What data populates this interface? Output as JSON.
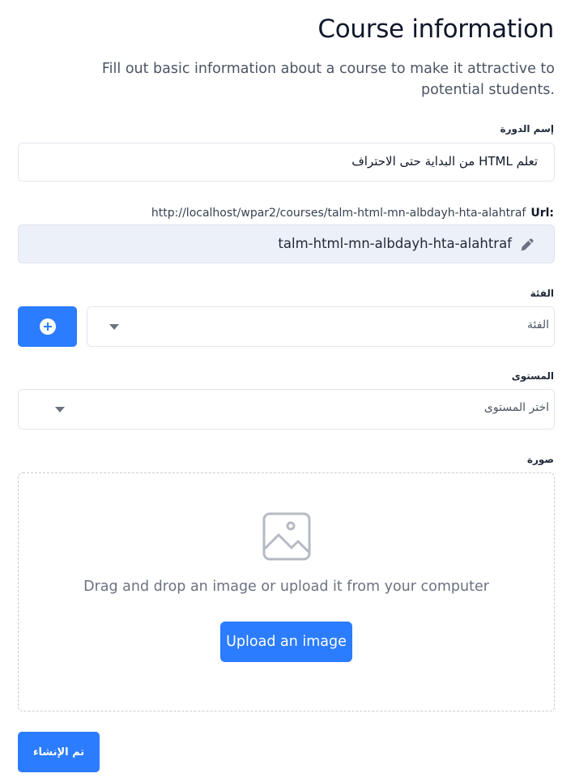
{
  "header": {
    "title": "Course information",
    "subtitle": "Fill out basic information about a course to make it attractive to potential students."
  },
  "course_name": {
    "label": "إسم الدورة",
    "value": "تعلم HTML من البداية حتى الاحتراف"
  },
  "url": {
    "label": "Url:",
    "base": "http://localhost/wpar2/courses/talm-html-mn-albdayh-hta-alahtraf",
    "slug": "talm-html-mn-albdayh-hta-alahtraf"
  },
  "category": {
    "label": "الفئة",
    "placeholder": "الفئة"
  },
  "level": {
    "label": "المستوى",
    "placeholder": "اختر المستوى"
  },
  "image": {
    "label": "صورة",
    "hint": "Drag and drop an image or upload it from your computer",
    "upload_label": "Upload an image"
  },
  "actions": {
    "create_label": "تم الإنشاء"
  },
  "colors": {
    "primary": "#2b7cff",
    "slug_bg": "#ecf0f9"
  }
}
